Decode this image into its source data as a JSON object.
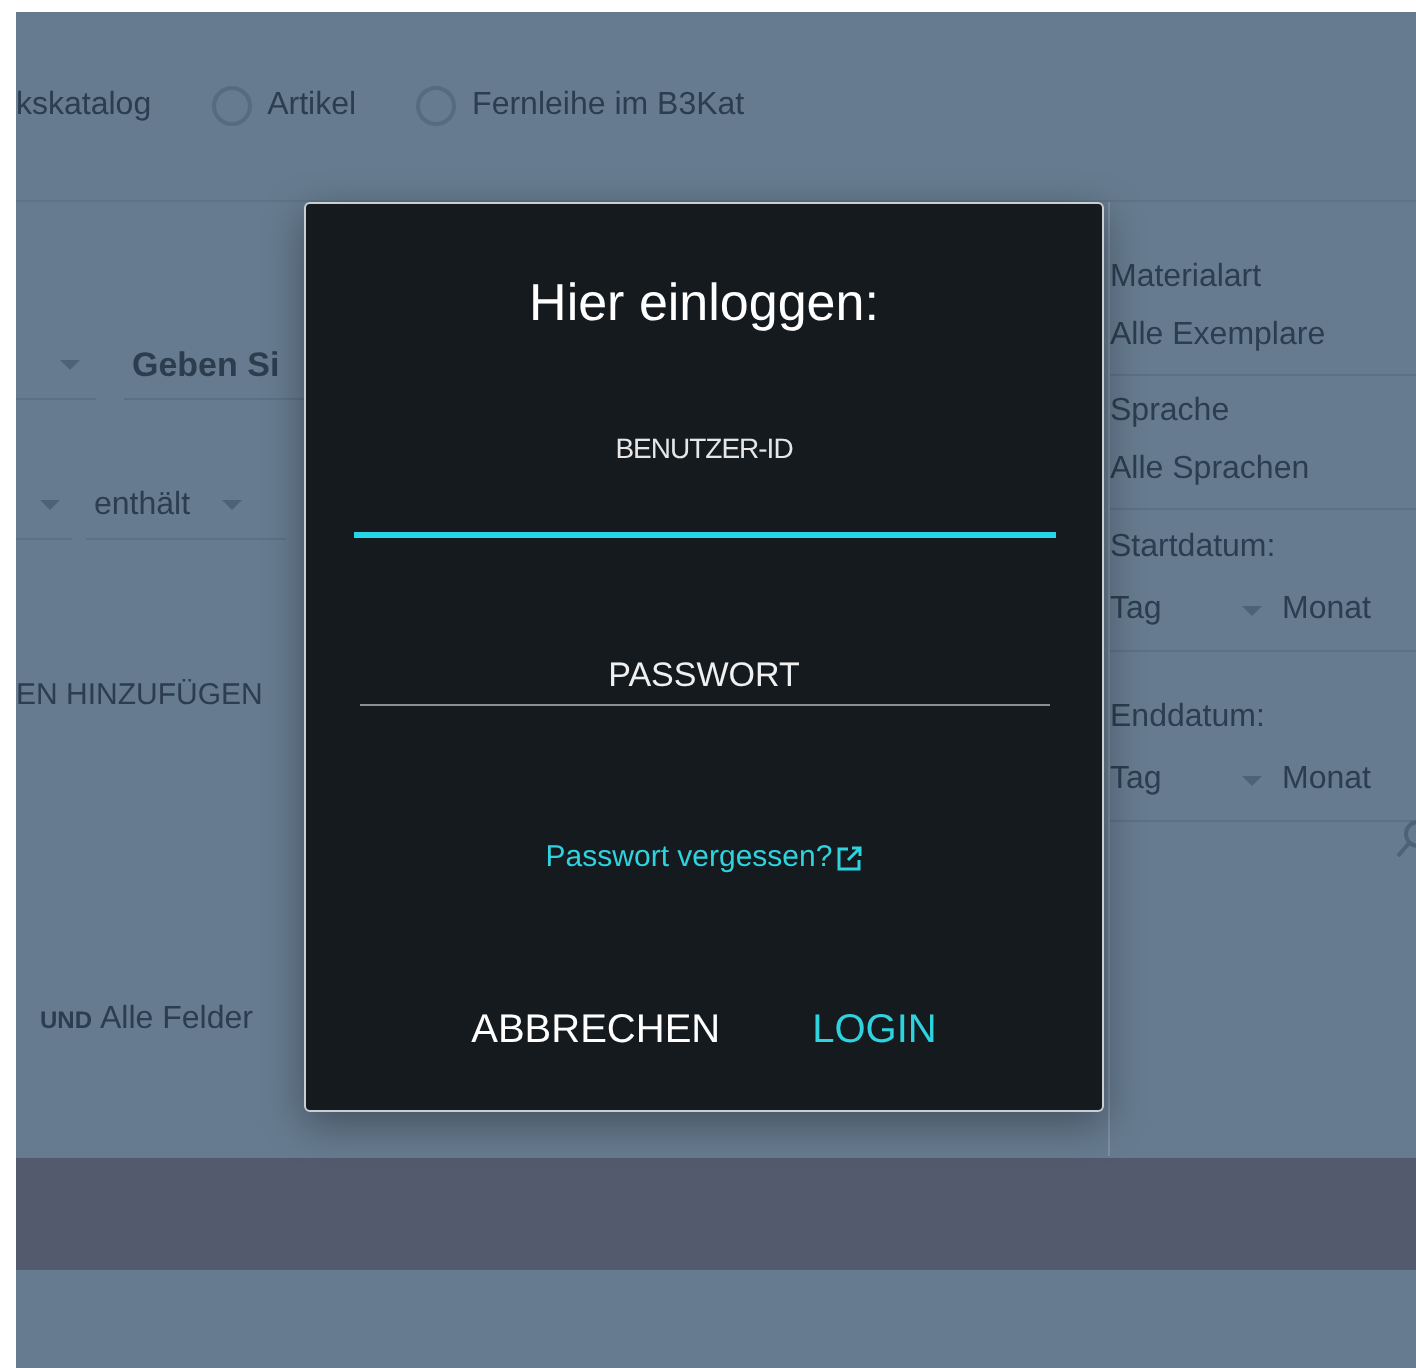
{
  "background_page": {
    "scope_partial_label": "kskatalog",
    "scope_options": [
      {
        "label": "Artikel",
        "selected": false
      },
      {
        "label": "Fernleihe im B3Kat",
        "selected": false
      }
    ],
    "query_row_1": {
      "placeholder": "Geben Si"
    },
    "query_row_2": {
      "operator": "enthält"
    },
    "add_fields_button": "EN HINZUFÜGEN",
    "simple_query": {
      "connector": "UND",
      "field": "Alle Felder"
    },
    "filters": [
      {
        "kind": "select",
        "label": "Materialart",
        "value": "Alle Exemplare"
      },
      {
        "kind": "select",
        "label": "Sprache",
        "value": "Alle Sprachen"
      },
      {
        "kind": "date",
        "label": "Startdatum:",
        "day": "Tag",
        "month": "Monat"
      },
      {
        "kind": "date",
        "label": "Enddatum:",
        "day": "Tag",
        "month": "Monat"
      }
    ]
  },
  "login_dialog": {
    "title": "Hier einloggen:",
    "fields": [
      {
        "label": "BENUTZER-ID",
        "focused": true
      },
      {
        "label": "PASSWORT",
        "focused": false
      }
    ],
    "forgot_link": "Passwort vergessen?",
    "buttons": [
      {
        "kind": "cancel",
        "label": "ABBRECHEN"
      },
      {
        "kind": "confirm",
        "label": "LOGIN"
      }
    ]
  }
}
